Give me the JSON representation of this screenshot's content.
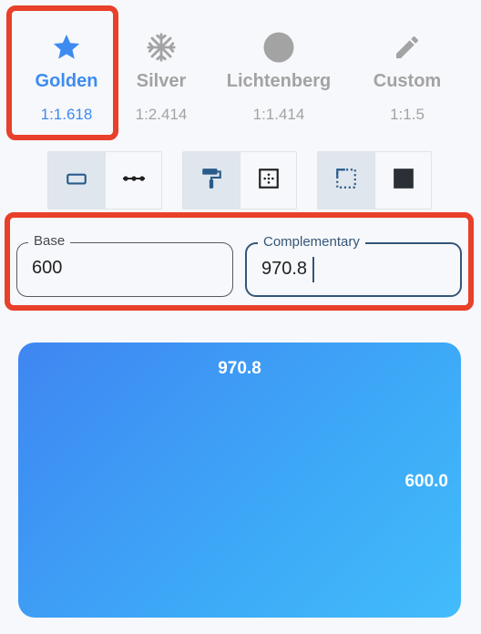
{
  "ratios": [
    {
      "name": "Golden",
      "value": "1:1.618",
      "icon": "star-icon",
      "active": true
    },
    {
      "name": "Silver",
      "value": "1:2.414",
      "icon": "snowflake-icon",
      "active": false
    },
    {
      "name": "Lichtenberg",
      "value": "1:1.414",
      "icon": "circle-icon",
      "active": false
    },
    {
      "name": "Custom",
      "value": "1:1.5",
      "icon": "pencil-icon",
      "active": false
    }
  ],
  "toggles": [
    {
      "items": [
        {
          "icon": "rectangle-outline-icon",
          "selected": true
        },
        {
          "icon": "dotted-line-icon",
          "selected": false
        }
      ]
    },
    {
      "items": [
        {
          "icon": "paint-roller-icon",
          "selected": true
        },
        {
          "icon": "border-inner-dots-icon",
          "selected": false
        }
      ]
    },
    {
      "items": [
        {
          "icon": "dashed-corner-square-icon",
          "selected": true
        },
        {
          "icon": "filled-square-icon",
          "selected": false
        }
      ]
    }
  ],
  "inputs": {
    "base": {
      "label": "Base",
      "value": "600"
    },
    "complementary": {
      "label": "Complementary",
      "value": "970.8"
    }
  },
  "preview": {
    "top_label": "970.8",
    "right_label": "600.0"
  },
  "colors": {
    "accent": "#3d8bf0",
    "highlight": "#e8402a",
    "inactive": "#a3a3a3",
    "gradient_start": "#3f86f2",
    "gradient_end": "#42bcfb"
  }
}
